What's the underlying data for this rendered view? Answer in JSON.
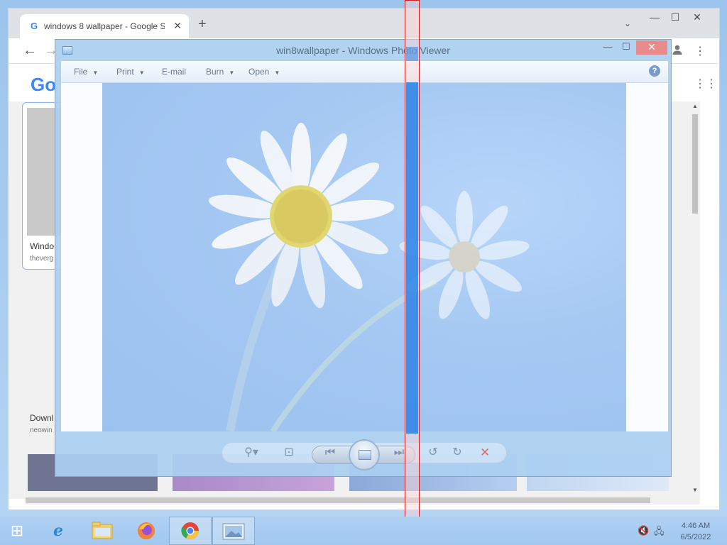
{
  "chrome": {
    "tab_title": "windows 8 wallpaper - Google S",
    "tab_close": "✕",
    "new_tab": "+",
    "tab_search": "⌄",
    "min": "—",
    "max": "☐",
    "close": "✕",
    "back": "←",
    "forward": "→",
    "account_icon": "account-icon",
    "menu_dots": "⋮",
    "google_logo": "Go",
    "apps": "⋮⋮",
    "result1_title": "Windo",
    "result1_source": "theverg",
    "result2_title": "Downl",
    "result2_source": "neowin"
  },
  "viewer": {
    "title": "win8wallpaper - Windows Photo Viewer",
    "minimize": "—",
    "maximize": "☐",
    "close": "✕",
    "menus": [
      {
        "label": "File",
        "caret": "▼"
      },
      {
        "label": "Print",
        "caret": "▼"
      },
      {
        "label": "E-mail",
        "caret": ""
      },
      {
        "label": "Burn",
        "caret": "▼"
      },
      {
        "label": "Open",
        "caret": "▼"
      }
    ],
    "help": "?",
    "controls": {
      "zoom": "⚲▾",
      "actual_size": "⊡",
      "previous": "⏮",
      "next": "⏭",
      "rotate_ccw": "↺",
      "rotate_cw": "↻",
      "delete": "✕"
    }
  },
  "taskbar": {
    "start": "⊞",
    "time": "4:46 AM",
    "date": "6/5/2022",
    "volume_icon": "🔇",
    "network_icon": "🖧"
  },
  "colors": {
    "highlight_border": "#cf1f1f",
    "highlight_fill": "#2684e8",
    "viewer_frame": "#aacff1",
    "close_button": "#e98b8b"
  }
}
